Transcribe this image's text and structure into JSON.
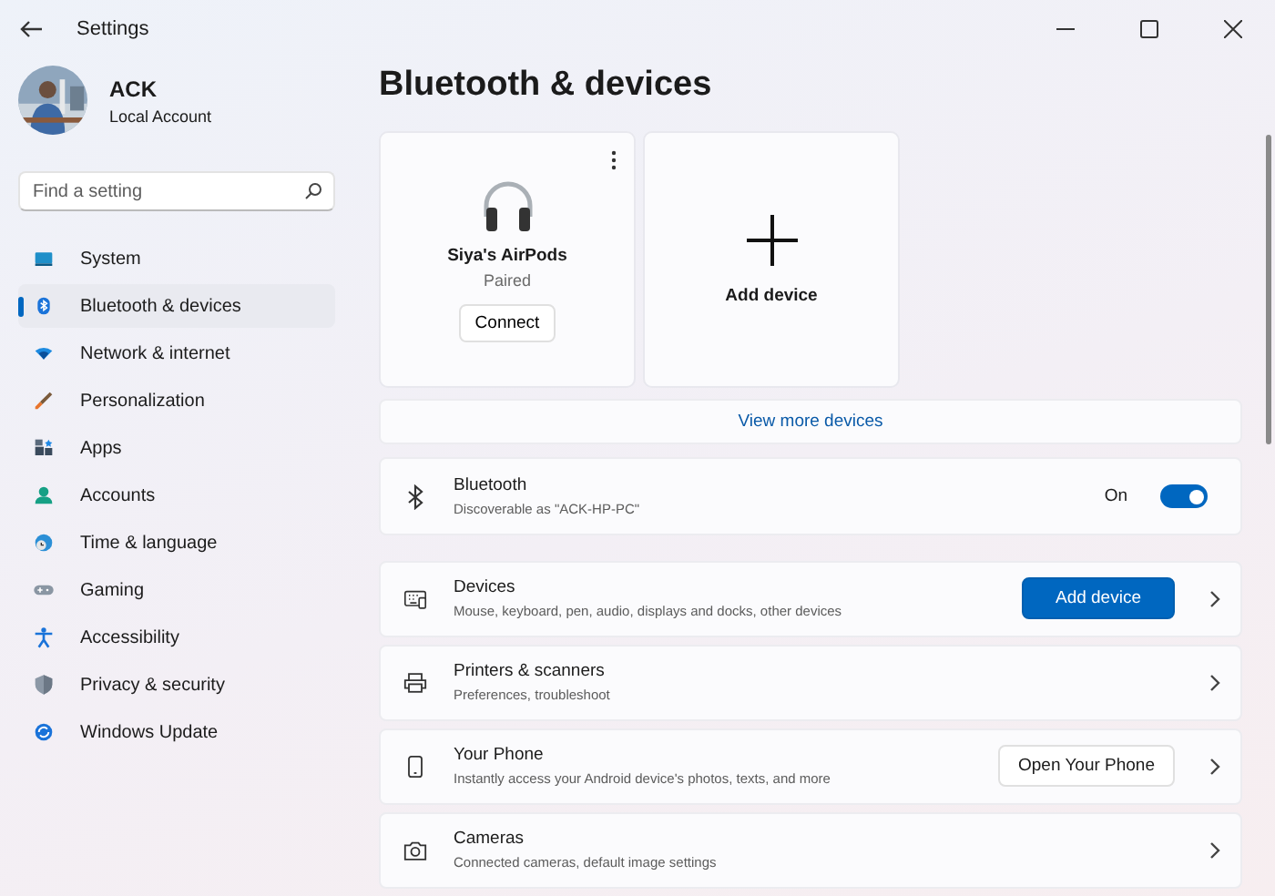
{
  "window": {
    "title": "Settings"
  },
  "account": {
    "name": "ACK",
    "type": "Local Account"
  },
  "search": {
    "placeholder": "Find a setting"
  },
  "sidebar": {
    "items": [
      {
        "label": "System",
        "selected": false
      },
      {
        "label": "Bluetooth & devices",
        "selected": true
      },
      {
        "label": "Network & internet",
        "selected": false
      },
      {
        "label": "Personalization",
        "selected": false
      },
      {
        "label": "Apps",
        "selected": false
      },
      {
        "label": "Accounts",
        "selected": false
      },
      {
        "label": "Time & language",
        "selected": false
      },
      {
        "label": "Gaming",
        "selected": false
      },
      {
        "label": "Accessibility",
        "selected": false
      },
      {
        "label": "Privacy & security",
        "selected": false
      },
      {
        "label": "Windows Update",
        "selected": false
      }
    ]
  },
  "page_title": "Bluetooth & devices",
  "device_cards": [
    {
      "kind": "device",
      "name": "Siya's AirPods",
      "status": "Paired",
      "button": "Connect"
    },
    {
      "kind": "add",
      "name": "Add device"
    }
  ],
  "view_more": "View more devices",
  "bluetooth": {
    "title": "Bluetooth",
    "subtitle": "Discoverable as \"ACK-HP-PC\"",
    "state_label": "On",
    "on": true
  },
  "rows": [
    {
      "title": "Devices",
      "subtitle": "Mouse, keyboard, pen, audio, displays and docks, other devices",
      "button": {
        "label": "Add device",
        "kind": "accent"
      }
    },
    {
      "title": "Printers & scanners",
      "subtitle": "Preferences, troubleshoot"
    },
    {
      "title": "Your Phone",
      "subtitle": "Instantly access your Android device's photos, texts, and more",
      "button": {
        "label": "Open Your Phone",
        "kind": "standard"
      }
    },
    {
      "title": "Cameras",
      "subtitle": "Connected cameras, default image settings"
    }
  ]
}
